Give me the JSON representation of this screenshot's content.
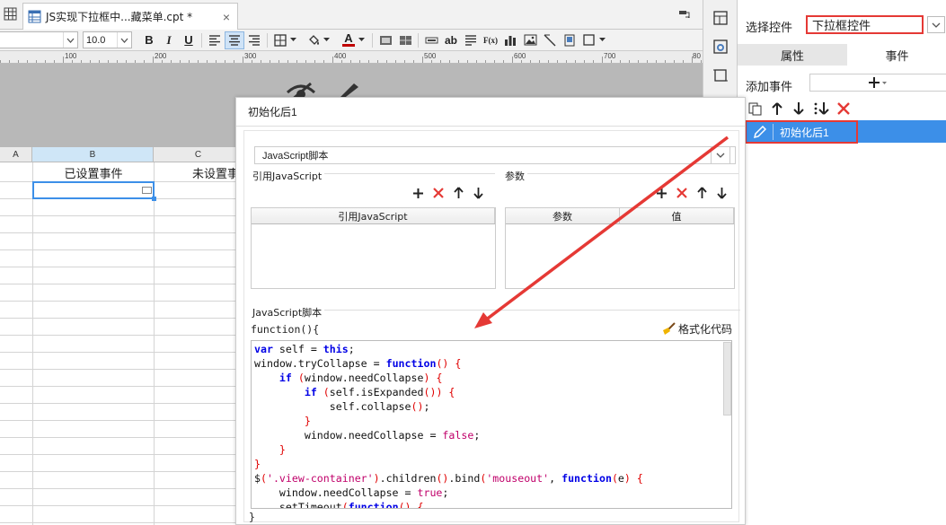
{
  "tab": {
    "title": "JS实现下拉框中...藏菜单.cpt *",
    "close": "×"
  },
  "toolbar": {
    "font_size": "10.0",
    "bold": "B",
    "italic": "I",
    "underline": "U",
    "ab_label": "ab",
    "fx_label": "F(x)"
  },
  "ruler": {
    "labels": [
      "100",
      "200",
      "300",
      "400",
      "500",
      "600",
      "700",
      "80"
    ]
  },
  "sheet": {
    "columns": [
      "A",
      "B",
      "C"
    ],
    "cells": {
      "b1": "已设置事件",
      "c1": "未设置事"
    }
  },
  "right_panel": {
    "select_label": "选择控件",
    "select_value": "下拉框控件",
    "tabs": [
      "属性",
      "事件"
    ],
    "add_event_label": "添加事件",
    "event_item": "初始化后1"
  },
  "dialog": {
    "title": "初始化后1",
    "script_type": "JavaScript脚本",
    "ref_section": "引用JavaScript",
    "param_section": "参数",
    "ref_column": "引用JavaScript",
    "param_columns": [
      "参数",
      "值"
    ],
    "script_section": "JavaScript脚本",
    "func_open": "function(){",
    "format_code": "格式化代码",
    "func_close": "}"
  },
  "colors": {
    "accent_blue": "#3c8fe8",
    "highlight_red": "#e53935"
  }
}
